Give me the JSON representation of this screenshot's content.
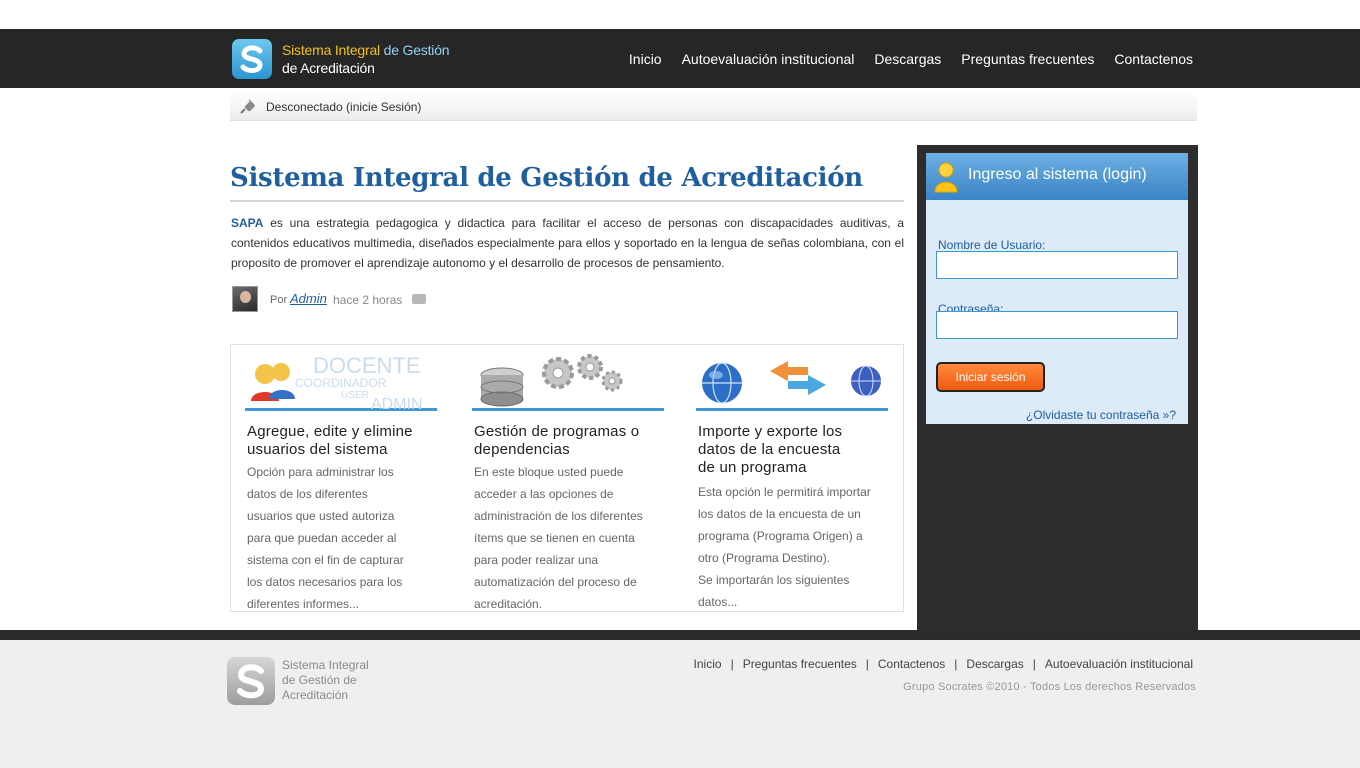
{
  "header": {
    "logo": {
      "line1_a": "Sistema Integral",
      "line1_b": " de Gestión",
      "line2": "de Acreditación"
    },
    "nav": [
      "Inicio",
      "Autoevaluación institucional",
      "Descargas",
      "Preguntas frecuentes",
      "Contactenos"
    ]
  },
  "statusbar": {
    "text": "Desconectado (inicie Sesión)",
    "icon": "plug-icon"
  },
  "main": {
    "title": "Sistema Integral de Gestión de Acreditación",
    "intro_brand": "SAPA",
    "intro_text": " es una estrategia pedagogica y didactica para facilitar el acceso de personas con discapacidades auditivas, a contenidos educativos multimedia, diseñados especialmente para ellos y soportado en la lengua de señas colombiana, con el proposito de promover el aprendizaje autonomo y el desarrollo de procesos de pensamiento.",
    "meta": {
      "by": "Por",
      "author": "Admin",
      "time": "hace 2 horas"
    },
    "features": [
      {
        "art_labels": {
          "docente": "DOCENTE",
          "coordinador": "COORDINADOR",
          "user": "USER",
          "admin": "ADMIN"
        },
        "title_l1": "Agregue, edite y elimine",
        "title_l2": "usuarios del sistema",
        "text": [
          "Opción para administrar los",
          "datos de los diferentes",
          "usuarios que usted autoriza",
          "para que puedan acceder al",
          "sistema con el fin de capturar",
          "los datos necesarios para los",
          "diferentes informes..."
        ]
      },
      {
        "title_l1": "Gestión de programas o",
        "title_l2": "dependencias",
        "text": [
          "En este bloque usted puede",
          "acceder a las opciones de",
          "administración de los diferentes",
          "ítems que se tienen en cuenta",
          "para poder realizar una",
          "automatización del proceso de",
          "acreditación."
        ]
      },
      {
        "title_l1": "Importe y exporte los",
        "title_l2": "datos de la encuesta",
        "title_l3": "de un programa",
        "text": [
          "Esta opción le permitirá importar",
          "los datos de la encuesta de un",
          "programa (Programa Origen) a",
          "otro (Programa Destino).",
          "Se importarán los siguientes",
          "datos..."
        ]
      }
    ]
  },
  "login": {
    "title": "Ingreso al sistema (login)",
    "username_label": "Nombre de Usuario:",
    "username_value": "",
    "password_label": "Contraseña:",
    "password_value": "",
    "submit": "Iniciar sesión",
    "forgot": "¿Olvidaste tu contraseña »?"
  },
  "footer": {
    "logo": {
      "line1": "Sistema Integral",
      "line2": "de Gestión de",
      "line3": "Acreditación"
    },
    "nav": [
      "Inicio",
      "Preguntas frecuentes",
      "Contactenos",
      "Descargas",
      "Autoevaluación institucional"
    ],
    "copyright": "Grupo Socrates ©2010  - Todos Los derechos Reservados"
  },
  "colors": {
    "header_bg": "#262626",
    "accent_blue": "#1f5fa0",
    "bar_blue": "#3f97d3",
    "login_bg": "#dcebf7",
    "button_orange": "#f05a0f",
    "footer_bg": "#efefef"
  }
}
